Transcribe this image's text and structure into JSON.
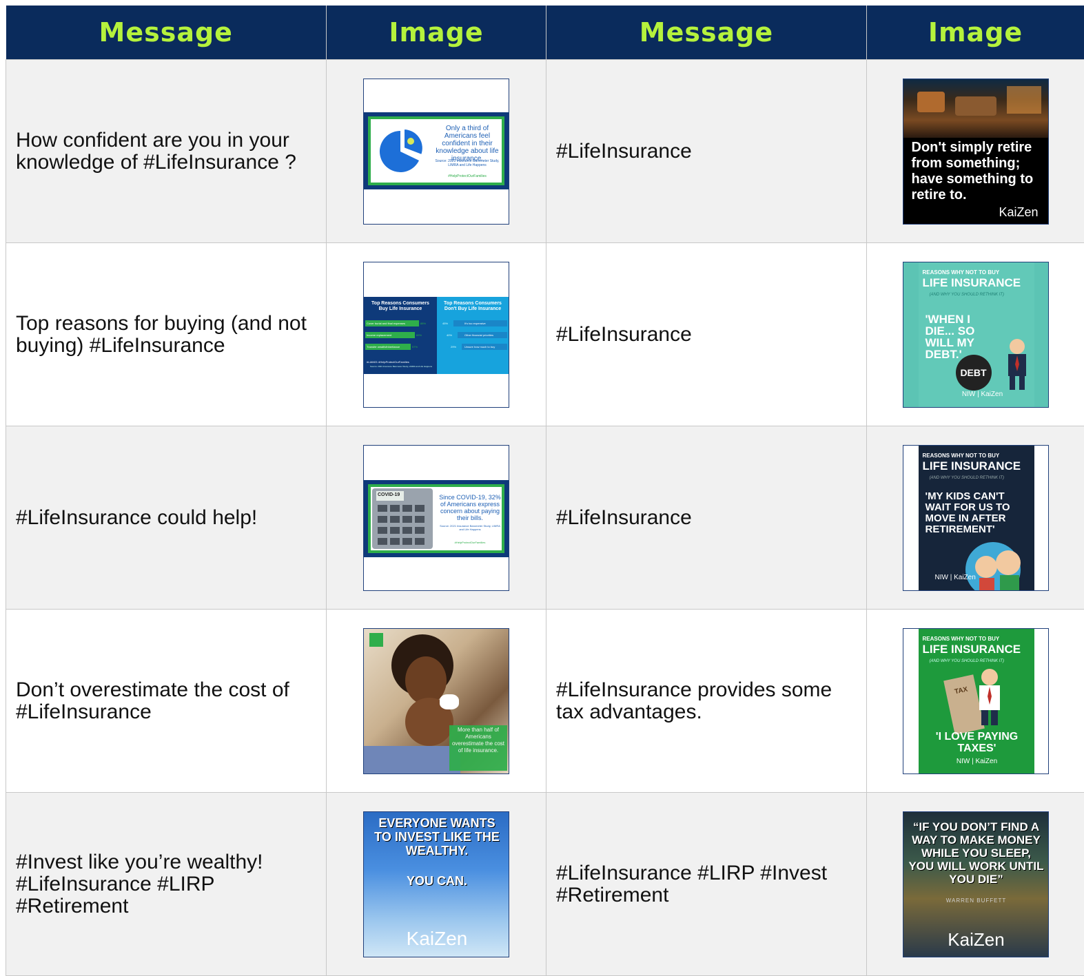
{
  "header": {
    "col1": "Message",
    "col2": "Image",
    "col3": "Message",
    "col4": "Image"
  },
  "rows": [
    {
      "message_left": "How confident are you in your knowledge of #LifeInsurance ?",
      "message_right": "#LifeInsurance",
      "img_left": {
        "text": "Only a third of Americans feel confident in their knowledge about life insurance.",
        "source": "Source: 2021 Insurance Barometer Study, LIMRA and Life Happens",
        "hashtag": "#HelpProtectOurFamilies"
      },
      "img_right": {
        "text": "Don't simply retire from something; have something to retire to.",
        "brand": "KaiZen"
      }
    },
    {
      "message_left": "Top reasons for buying (and not buying) #LifeInsurance",
      "message_right": "#LifeInsurance",
      "img_left": {
        "left_title": "Top Reasons Consumers Buy Life Insurance",
        "right_title": "Top Reasons Consumers Don't Buy Life Insurance",
        "left_items": [
          "Cover burial and final expenses",
          "Income replacement",
          "Transfer wealth/inheritance"
        ],
        "left_values": [
          "88%",
          "69%",
          "57%"
        ],
        "right_items": [
          "It's too expensive",
          "Other financial priorities",
          "Unsure how much to buy"
        ],
        "right_values": [
          "45%",
          "40%",
          "29%"
        ],
        "footer": "#LIAM21 #HelpProtectOurFamilies",
        "source": "Source: 2021 Insurance Barometer Study, LIMRA and Life Happens"
      },
      "img_right": {
        "kicker": "REASONS WHY NOT TO BUY",
        "title": "LIFE INSURANCE",
        "subtitle": "(AND WHY YOU SHOULD RETHINK IT)",
        "quote": "'WHEN I DIE... SO WILL MY DEBT.'",
        "ball": "DEBT",
        "logos": "NIW | KaiZen"
      }
    },
    {
      "message_left": "#LifeInsurance could help!",
      "message_right": "#LifeInsurance",
      "img_left": {
        "calc_label": "COVID-19",
        "text": "Since COVID-19, 32% of Americans express concern about paying their bills.",
        "source": "Source: 2021 Insurance Barometer Study, LIMRA and Life Happens",
        "hashtag": "#HelpProtectOurFamilies"
      },
      "img_right": {
        "kicker": "REASONS WHY NOT TO BUY",
        "title": "LIFE INSURANCE",
        "subtitle": "(AND WHY YOU SHOULD RETHINK IT)",
        "quote": "'MY KIDS CAN'T WAIT FOR US TO MOVE IN AFTER RETIREMENT'",
        "logos": "NIW | KaiZen"
      }
    },
    {
      "message_left": "Don’t overestimate the cost of #LifeInsurance",
      "message_right": "#LifeInsurance provides some tax advantages.",
      "img_left": {
        "text": "More than half of Americans overestimate the cost of life insurance."
      },
      "img_right": {
        "kicker": "REASONS WHY NOT TO BUY",
        "title": "LIFE INSURANCE",
        "subtitle": "(AND WHY YOU SHOULD RETHINK IT)",
        "paper": "TAX",
        "quote": "'I LOVE PAYING TAXES'",
        "logos": "NIW | KaiZen"
      }
    },
    {
      "message_left": "#Invest like you’re wealthy!\n#LifeInsurance #LIRP\n#Retirement",
      "message_right": "#LifeInsurance #LIRP #Invest\n#Retirement",
      "img_left": {
        "line1": "EVERYONE WANTS TO INVEST LIKE THE WEALTHY.",
        "line2": "YOU CAN.",
        "brand": "KaiZen"
      },
      "img_right": {
        "quote": "“IF YOU DON’T FIND A WAY TO MAKE MONEY WHILE YOU SLEEP, YOU WILL WORK UNTIL YOU DIE”",
        "attribution": "WARREN BUFFETT",
        "brand": "KaiZen"
      }
    }
  ],
  "colors": {
    "header_bg": "#0a2b5c",
    "header_text": "#b5f23c",
    "row_alt": "#f1f1f1",
    "kaizen_green": "#2fae4b",
    "teal": "#5cc4b4"
  }
}
